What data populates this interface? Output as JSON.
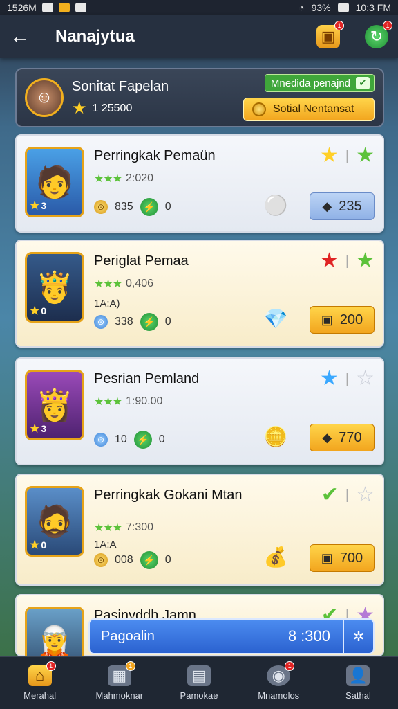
{
  "status_bar": {
    "time_left": "1526M",
    "battery": "93%",
    "time_right": "10:3 FM"
  },
  "app_bar": {
    "back_glyph": "←",
    "title": "Nanajytua",
    "gold_badge": "1",
    "green_badge": "1"
  },
  "profile": {
    "name": "Sonitat Fapelan",
    "score": "1 25500",
    "green_button": "Mnedida penajnd",
    "gold_button": "Sotial Nentansat"
  },
  "cards": [
    {
      "title": "Perringkak Pemaün",
      "rating": "2:020",
      "extra": "",
      "portrait_badge": "3",
      "stat_gold": "835",
      "stat_count": "0",
      "reward_value": "235",
      "reward_style": "blue"
    },
    {
      "title": "Periglat Pemaa",
      "rating": "0,406",
      "extra": "1A:A)",
      "portrait_badge": "0",
      "stat_gold": "338",
      "stat_count": "0",
      "reward_value": "200",
      "reward_style": "gold"
    },
    {
      "title": "Pesrian Pemland",
      "rating": "1:90.00",
      "extra": "",
      "portrait_badge": "3",
      "stat_gold": "10",
      "stat_count": "0",
      "reward_value": "770",
      "reward_style": "gold"
    },
    {
      "title": "Perringkak Gokani Mtan",
      "rating": "7:300",
      "extra": "1A:A",
      "portrait_badge": "0",
      "stat_gold": "008",
      "stat_count": "0",
      "reward_value": "700",
      "reward_style": "gold"
    },
    {
      "title": "Pasinyddh Jamn"
    }
  ],
  "overlay": {
    "label": "Pagoalin",
    "value": "8 :300"
  },
  "bottom_nav": [
    {
      "label": "Merahal",
      "badge": "1"
    },
    {
      "label": "Mahmoknar",
      "badge": "1"
    },
    {
      "label": "Pamokae",
      "badge": ""
    },
    {
      "label": "Mnamolos",
      "badge": "1"
    },
    {
      "label": "Sathal",
      "badge": ""
    }
  ],
  "colors": {
    "accent_gold": "#f2a51e",
    "accent_green": "#3fa63a",
    "accent_blue": "#2b62d0",
    "nav_bg": "#1f2733"
  }
}
